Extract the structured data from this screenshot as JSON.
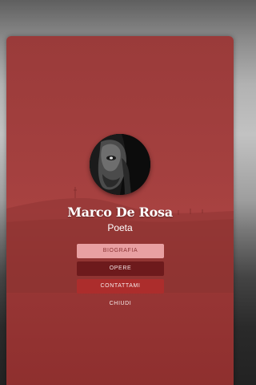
{
  "profile": {
    "name": "Marco De Rosa",
    "role": "Poeta"
  },
  "menu": {
    "biografia": "BIOGRAFIA",
    "opere": "OPERE",
    "contattami": "CONTATTAMI",
    "chiudi": "CHIUDI"
  },
  "colors": {
    "card": "#a4403f",
    "button_light": "#e8a0a2",
    "button_dark": "#6d1a1c",
    "button_red": "#ac2d2c"
  }
}
